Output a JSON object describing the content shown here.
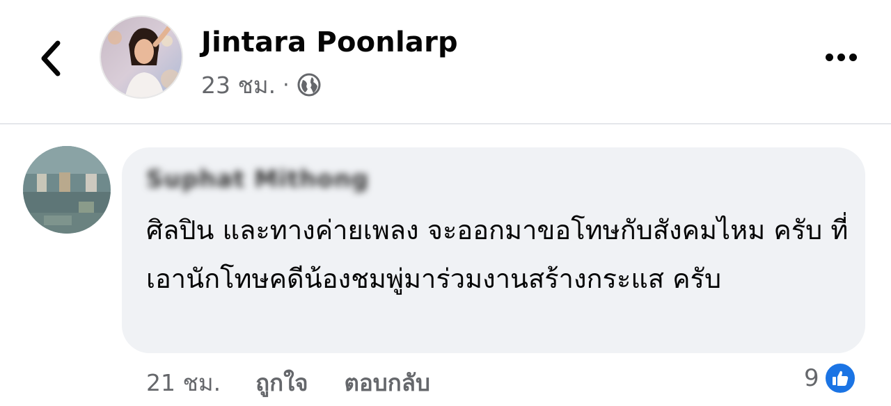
{
  "post": {
    "author": "Jintara Poonlarp",
    "time": "23 ชม.",
    "separator": "·",
    "visibility_icon": "globe-icon"
  },
  "header": {
    "back_icon": "chevron-left-icon",
    "more_icon": "more-horizontal-icon"
  },
  "comment": {
    "author": "Suphat Mithong",
    "author_blurred": true,
    "text": "ศิลปิน และทางค่ายเพลง จะออกมาขอโทษกับสังคมไหม ครับ ที่เอานักโทษคดีน้องชมพู่มาร่วมงานสร้างกระแส ครับ",
    "time": "21 ชม.",
    "like_label": "ถูกใจ",
    "reply_label": "ตอบกลับ",
    "reaction_count": "9",
    "reaction_icon": "thumbs-up-icon"
  },
  "colors": {
    "bubble_bg": "#f0f2f5",
    "secondary_text": "#65676b",
    "like_blue": "#1b74e4"
  }
}
